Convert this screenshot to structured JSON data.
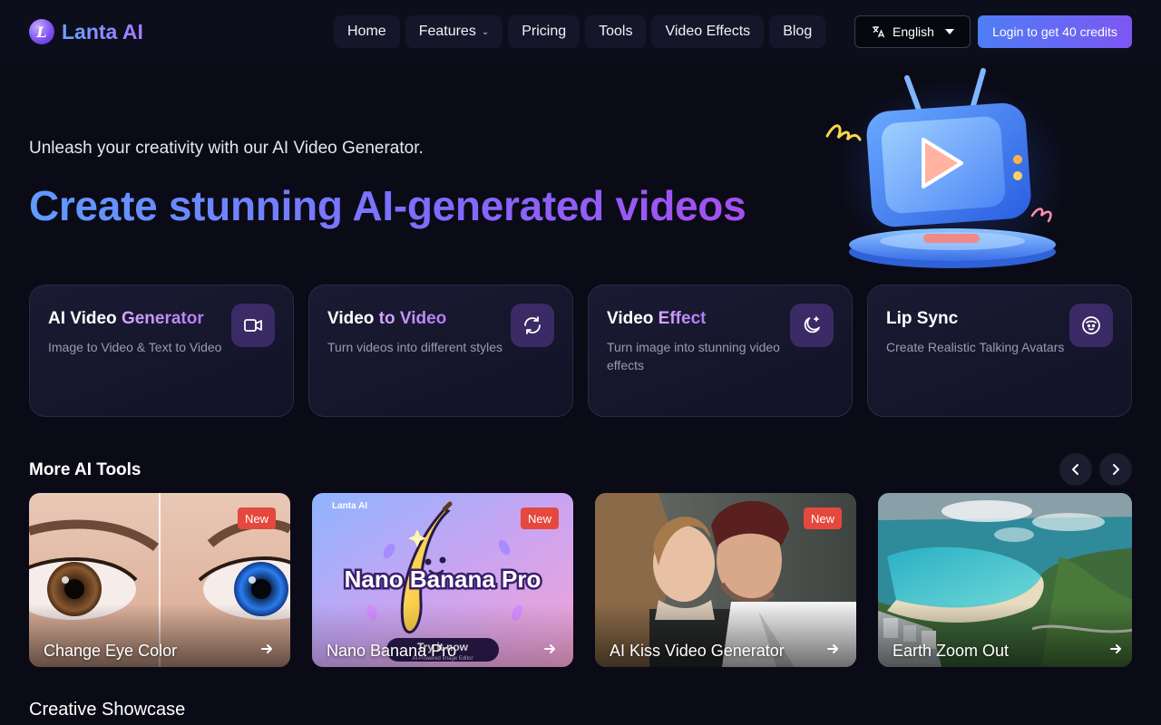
{
  "header": {
    "brand": "Lanta AI",
    "logo_letter": "L",
    "nav": [
      {
        "label": "Home"
      },
      {
        "label": "Features",
        "has_dropdown": true
      },
      {
        "label": "Pricing"
      },
      {
        "label": "Tools"
      },
      {
        "label": "Video Effects"
      },
      {
        "label": "Blog"
      }
    ],
    "language": "English",
    "login": "Login to get 40 credits"
  },
  "hero": {
    "subtitle": "Unleash your creativity with our AI Video Generator.",
    "title": "Create stunning AI-generated videos"
  },
  "features": [
    {
      "title_plain": "AI Video ",
      "title_hl": "Generator",
      "desc": "Image to Video & Text to Video",
      "icon": "video-camera-icon"
    },
    {
      "title_plain": "Video ",
      "title_hl": "to Video",
      "desc": "Turn videos into different styles",
      "icon": "refresh-icon"
    },
    {
      "title_plain": "Video ",
      "title_hl": "Effect",
      "desc": "Turn image into stunning video effects",
      "icon": "moon-sparkle-icon"
    },
    {
      "title_plain": "Lip Sync",
      "title_hl": "",
      "desc": "Create Realistic Talking Avatars",
      "icon": "face-icon"
    }
  ],
  "more_tools": {
    "title": "More AI Tools",
    "items": [
      {
        "name": "Change Eye Color",
        "badge": "New"
      },
      {
        "name": "Nano Banana Pro",
        "badge": "New",
        "image_brand": "Lanta AI",
        "image_title": "Nano Banana Pro",
        "image_button": "Try it now",
        "image_caption": "AI-Powered Image Editor"
      },
      {
        "name": "AI Kiss Video Generator",
        "badge": "New"
      },
      {
        "name": "Earth Zoom Out",
        "badge": ""
      }
    ]
  },
  "showcase": {
    "title": "Creative Showcase"
  },
  "colors": {
    "accent_blue": "#4e7df5",
    "accent_purple": "#7d57f2",
    "badge_red": "#e5483e",
    "background": "#0a0b16"
  }
}
